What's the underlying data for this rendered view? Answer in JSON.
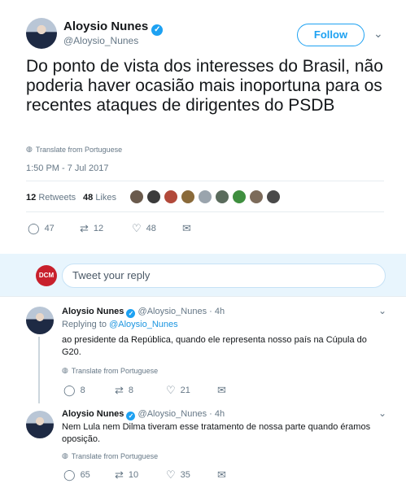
{
  "main": {
    "author_name": "Aloysio Nunes",
    "author_handle": "@Aloysio_Nunes",
    "follow_label": "Follow",
    "text": "Do ponto de vista dos interesses do Brasil, não poderia haver ocasião mais inoportuna para os recentes ataques de dirigentes do PSDB",
    "translate": "Translate from Portuguese",
    "timestamp": "1:50 PM - 7 Jul 2017",
    "retweets_count": "12",
    "retweets_label": "Retweets",
    "likes_count": "48",
    "likes_label": "Likes",
    "actions": {
      "replies": "47",
      "retweets": "12",
      "likes": "48"
    }
  },
  "reply_composer": {
    "avatar_text": "DCM",
    "placeholder": "Tweet your reply"
  },
  "replies": [
    {
      "author_name": "Aloysio Nunes",
      "author_handle": "@Aloysio_Nunes",
      "time": "4h",
      "replying_to_prefix": "Replying to",
      "replying_to": "@Aloysio_Nunes",
      "text": "ao presidente da República, quando ele representa nosso país na Cúpula do G20.",
      "translate": "Translate from Portuguese",
      "actions": {
        "replies": "8",
        "retweets": "8",
        "likes": "21"
      }
    },
    {
      "author_name": "Aloysio Nunes",
      "author_handle": "@Aloysio_Nunes",
      "time": "4h",
      "text": "Nem Lula nem Dilma tiveram esse tratamento de nossa parte quando éramos oposição.",
      "translate": "Translate from Portuguese",
      "actions": {
        "replies": "65",
        "retweets": "10",
        "likes": "35"
      }
    }
  ],
  "colors": {
    "accent": "#1da1f2",
    "text": "#14171a",
    "muted": "#657786",
    "bg_band": "#e6ecf0"
  }
}
